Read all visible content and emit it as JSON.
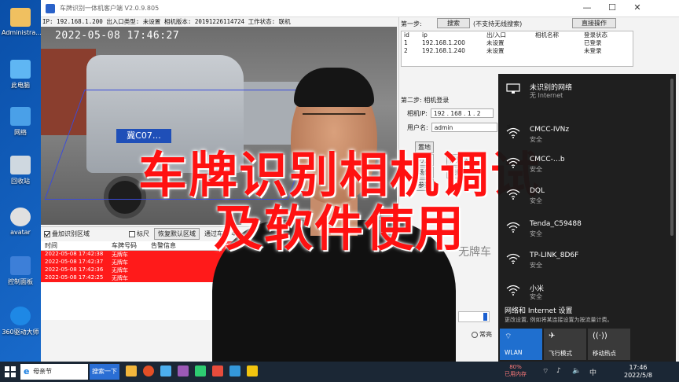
{
  "desktop": {
    "icons": [
      {
        "label": "Administra...",
        "icon": "user-folder-icon"
      },
      {
        "label": "此电脑",
        "icon": "computer-icon"
      },
      {
        "label": "网络",
        "icon": "network-icon"
      },
      {
        "label": "回收站",
        "icon": "recycle-bin-icon"
      },
      {
        "label": "avatar",
        "icon": "avatar-icon"
      },
      {
        "label": "控制面板",
        "icon": "control-panel-icon"
      },
      {
        "label": "360驱动大师",
        "icon": "driver-master-icon"
      }
    ]
  },
  "client_window": {
    "title": "车牌识别一体机客户端 V2.0.9.805",
    "status_line": "IP: 192.168.1.200  出入口类型: 未设置  相机版本: 20191226114724  工作状态: 联机",
    "controls": {
      "minimize": "—",
      "maximize": "☐",
      "close": "✕"
    }
  },
  "video": {
    "timestamp": "2022-05-08  17:46:27",
    "plate_text": "冀C07…"
  },
  "video_bar": {
    "show_roi_label": "叠加识别区域",
    "show_roi_checked": true,
    "mark_label": "标尺",
    "mark_checked": false,
    "restore_roi_button": "恢复默认区域",
    "pass_count_label": "通过车辆 4"
  },
  "records": {
    "columns": [
      "时间",
      "车牌号码",
      "告警信息"
    ],
    "rows": [
      {
        "time": "2022-05-08 17:42:38",
        "plate": "无牌车",
        "alarm": ""
      },
      {
        "time": "2022-05-08 17:42:37",
        "plate": "无牌车",
        "alarm": ""
      },
      {
        "time": "2022-05-08 17:42:36",
        "plate": "无牌车",
        "alarm": ""
      },
      {
        "time": "2022-05-08 17:42:25",
        "plate": "无牌车",
        "alarm": ""
      }
    ],
    "side_header": "车牌"
  },
  "config_panel": {
    "step1_label": "第一步:",
    "search_button": "搜索",
    "search_note": "(不支持无线搜索)",
    "operation_button": "直接操作",
    "device_columns": [
      "id",
      "ip",
      "出/入口",
      "相机名称",
      "登录状态"
    ],
    "devices": [
      {
        "id": "1",
        "ip": "192.168.1.200",
        "entry": "未设置",
        "name": "",
        "status": "已登录"
      },
      {
        "id": "2",
        "ip": "192.168.1.240",
        "entry": "未设置",
        "name": "",
        "status": "未登录"
      }
    ],
    "step2_label": "第二步: 相机登录",
    "ip_label": "相机IP:",
    "ip_value": "192 . 168 . 1 . 2",
    "user_label": "用户名:",
    "user_value": "admin",
    "pwd_label": "密",
    "partial_buttons": [
      "置地",
      "方式",
      "视频路",
      "场景",
      "视频",
      "参数"
    ],
    "plate_preview": "无牌车",
    "radio_label": "常亮"
  },
  "overlay": {
    "line1": "车牌识别相机调试",
    "line2": "及软件使用"
  },
  "wifi_flyout": {
    "networks": [
      {
        "name": "未识别的网络",
        "status": "无 Internet",
        "icon": "ethernet-icon"
      },
      {
        "name": "CMCC-IVNz",
        "status": "安全",
        "icon": "wifi-icon"
      },
      {
        "name": "CMCC-…b",
        "status": "安全",
        "icon": "wifi-icon"
      },
      {
        "name": "DQL",
        "status": "安全",
        "icon": "wifi-icon"
      },
      {
        "name": "Tenda_C59488",
        "status": "安全",
        "icon": "wifi-icon"
      },
      {
        "name": "TP-LINK_8D6F",
        "status": "安全",
        "icon": "wifi-icon"
      },
      {
        "name": "小米",
        "status": "安全",
        "icon": "wifi-icon"
      }
    ],
    "settings_title": "网络和 Internet 设置",
    "settings_desc": "更改设置, 例如将某连接设置为按流量计费。",
    "tiles": [
      {
        "label": "WLAN",
        "icon": "wifi-icon",
        "active": true
      },
      {
        "label": "飞行模式",
        "icon": "airplane-icon",
        "active": false
      },
      {
        "label": "移动热点",
        "icon": "hotspot-icon",
        "active": false
      }
    ]
  },
  "taskbar": {
    "browser_text": "母亲节",
    "search_button": "搜索一下",
    "cpu_usage": "80%",
    "cpu_label": "已用内存",
    "time": "17:46",
    "date": "2022/5/8",
    "lang": "中"
  },
  "colors": {
    "accent_blue": "#2a6ed4",
    "alert_red": "#ff1a1a",
    "overlay_red": "#ff1111",
    "flyout_bg": "#181818",
    "tile_active": "#1f6fcf"
  }
}
